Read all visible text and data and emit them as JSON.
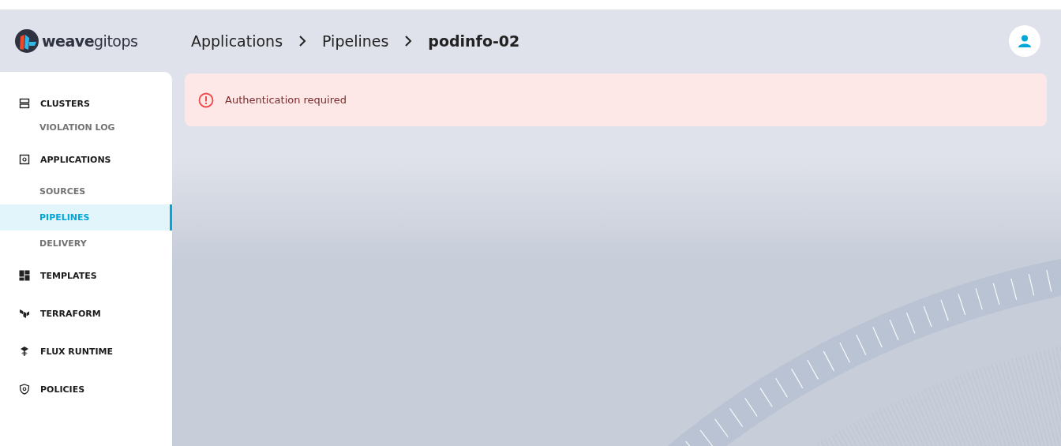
{
  "logo": {
    "bold": "weave",
    "light": "gitops"
  },
  "breadcrumbs": [
    {
      "label": "Applications",
      "current": false
    },
    {
      "label": "Pipelines",
      "current": false
    },
    {
      "label": "podinfo-02",
      "current": true
    }
  ],
  "sidebar": {
    "items": [
      {
        "label": "CLUSTERS",
        "kind": "section",
        "selected": false
      },
      {
        "label": "VIOLATION LOG",
        "kind": "sub",
        "selected": false
      },
      {
        "label": "APPLICATIONS",
        "kind": "section",
        "selected": false
      },
      {
        "label": "SOURCES",
        "kind": "sub",
        "selected": false
      },
      {
        "label": "PIPELINES",
        "kind": "sub",
        "selected": true
      },
      {
        "label": "DELIVERY",
        "kind": "sub",
        "selected": false
      },
      {
        "label": "TEMPLATES",
        "kind": "section",
        "selected": false
      },
      {
        "label": "TERRAFORM",
        "kind": "section",
        "selected": false
      },
      {
        "label": "FLUX RUNTIME",
        "kind": "section",
        "selected": false
      },
      {
        "label": "POLICIES",
        "kind": "section",
        "selected": false
      }
    ]
  },
  "alert": {
    "kind": "error",
    "message": "Authentication required"
  }
}
